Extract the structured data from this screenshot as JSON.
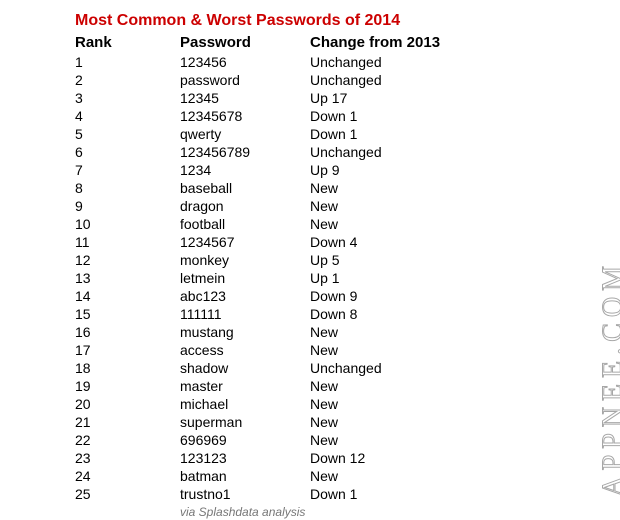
{
  "title": "Most Common & Worst Passwords of 2014",
  "headers": {
    "rank": "Rank",
    "password": "Password",
    "change": "Change from 2013"
  },
  "rows": [
    {
      "rank": "1",
      "password": "123456",
      "change": "Unchanged"
    },
    {
      "rank": "2",
      "password": "password",
      "change": "Unchanged"
    },
    {
      "rank": "3",
      "password": "12345",
      "change": "Up 17"
    },
    {
      "rank": "4",
      "password": "12345678",
      "change": "Down 1"
    },
    {
      "rank": "5",
      "password": "qwerty",
      "change": "Down 1"
    },
    {
      "rank": "6",
      "password": "123456789",
      "change": "Unchanged"
    },
    {
      "rank": "7",
      "password": "1234",
      "change": "Up 9"
    },
    {
      "rank": "8",
      "password": "baseball",
      "change": "New"
    },
    {
      "rank": "9",
      "password": "dragon",
      "change": "New"
    },
    {
      "rank": "10",
      "password": "football",
      "change": "New"
    },
    {
      "rank": "11",
      "password": "1234567",
      "change": "Down 4"
    },
    {
      "rank": "12",
      "password": "monkey",
      "change": "Up 5"
    },
    {
      "rank": "13",
      "password": "letmein",
      "change": "Up 1"
    },
    {
      "rank": "14",
      "password": "abc123",
      "change": "Down 9"
    },
    {
      "rank": "15",
      "password": "111111",
      "change": "Down 8"
    },
    {
      "rank": "16",
      "password": "mustang",
      "change": "New"
    },
    {
      "rank": "17",
      "password": "access",
      "change": "New"
    },
    {
      "rank": "18",
      "password": "shadow",
      "change": "Unchanged"
    },
    {
      "rank": "19",
      "password": "master",
      "change": "New"
    },
    {
      "rank": "20",
      "password": "michael",
      "change": "New"
    },
    {
      "rank": "21",
      "password": "superman",
      "change": "New"
    },
    {
      "rank": "22",
      "password": "696969",
      "change": "New"
    },
    {
      "rank": "23",
      "password": "123123",
      "change": "Down 12"
    },
    {
      "rank": "24",
      "password": "batman",
      "change": "New"
    },
    {
      "rank": "25",
      "password": "trustno1",
      "change": "Down 1"
    }
  ],
  "source": "via Splashdata analysis",
  "watermark": "APPNEE.COM"
}
